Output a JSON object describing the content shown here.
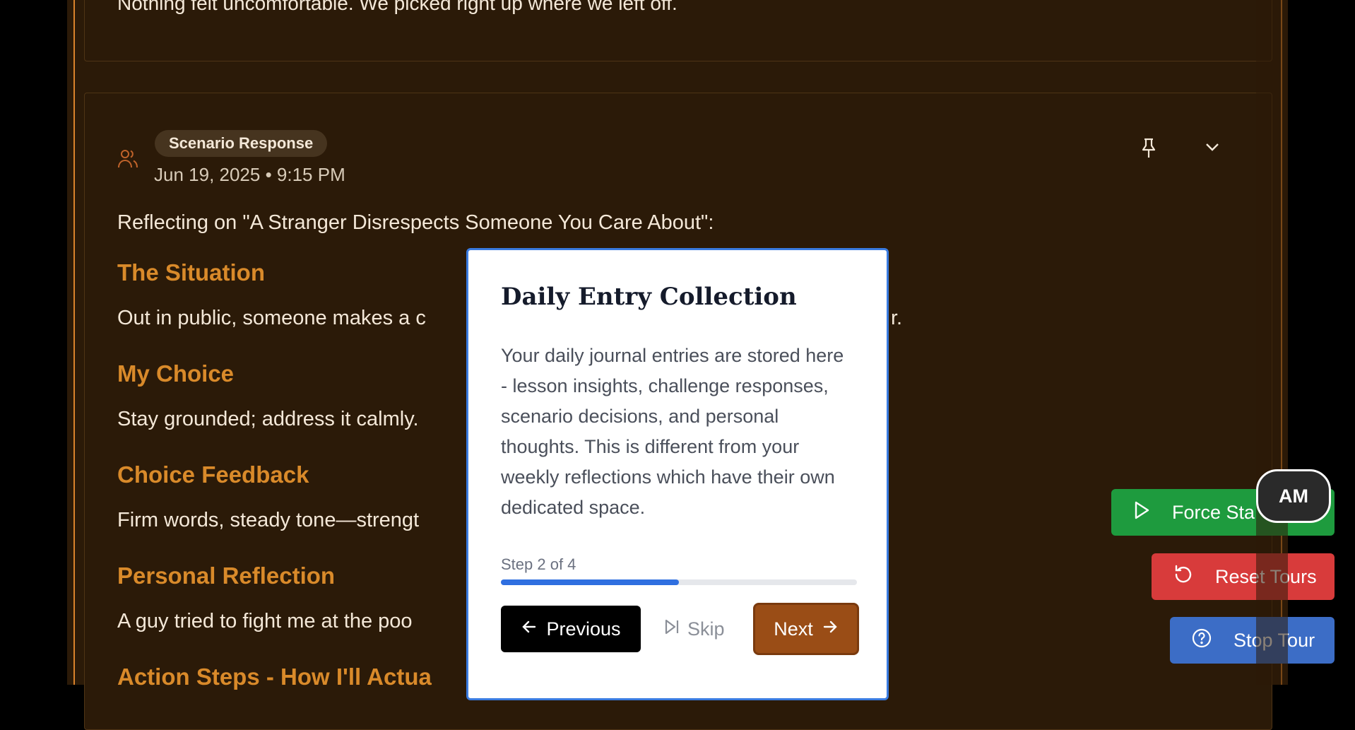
{
  "previous_entry": {
    "text": "Nothing felt uncomfortable. We picked right up where we left off."
  },
  "entry": {
    "badge": "Scenario Response",
    "date": "Jun 19, 2025 • 9:15 PM",
    "intro": "Reflecting on \"A Stranger Disrespects Someone You Care About\":",
    "sections": [
      {
        "heading": "The Situation",
        "text": "Out in public, someone makes a c"
      },
      {
        "heading": "My Choice",
        "text": "Stay grounded; address it calmly."
      },
      {
        "heading": "Choice Feedback",
        "text": "Firm words, steady tone—strengt"
      },
      {
        "heading": "Personal Reflection",
        "text": "A guy tried to fight me at the poo"
      }
    ],
    "situation_tail": "r.",
    "next_heading": "Action Steps - How I'll Actua"
  },
  "tour": {
    "title": "Daily Entry Collection",
    "body": "Your daily journal entries are stored here - lesson insights, challenge responses, scenario decisions, and personal thoughts. This is different from your weekly reflections which have their own dedicated space.",
    "step_label": "Step 2 of 4",
    "progress": 0.5,
    "previous_label": "Previous",
    "skip_label": "Skip",
    "next_label": "Next"
  },
  "floating": {
    "force_label": "Force Sta",
    "reset_label": "Reset Tours",
    "stop_label": "Stop Tour",
    "avatar_initials": "AM"
  },
  "colors": {
    "accent": "#d98a2a",
    "force": "#1e9b3e",
    "reset": "#d83b3b",
    "stop": "#3c6dc6",
    "next": "#9a4d16"
  }
}
